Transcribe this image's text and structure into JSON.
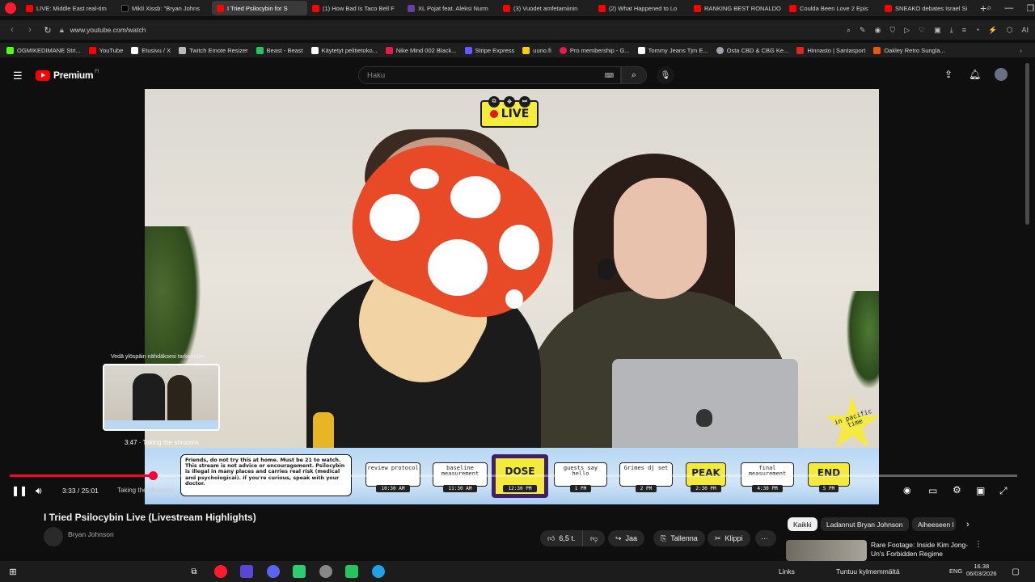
{
  "browser": {
    "tabs": [
      {
        "label": "LIVE: Middle East real-tim",
        "color": "#ff0000"
      },
      {
        "label": "Mikli Xissb: \"Bryan Johns",
        "color": "#000000"
      },
      {
        "label": "I Tried Psilocybin for S",
        "color": "#ff0000",
        "active": true
      },
      {
        "label": "(1) How Bad Is Taco Bell F",
        "color": "#ff0000"
      },
      {
        "label": "XL Pojat feat. Aleksi Nurm",
        "color": "#6441a5"
      },
      {
        "label": "(3) Vuodet amfetamiinin",
        "color": "#ff0000"
      },
      {
        "label": "(2) What Happened to Lo",
        "color": "#ff0000"
      },
      {
        "label": "RANKING BEST RONALDO",
        "color": "#ff0000"
      },
      {
        "label": "Coulda Been Love 2 Epis",
        "color": "#ff0000"
      },
      {
        "label": "SNEAKO debates Israel Si",
        "color": "#ff0000"
      }
    ],
    "url": "www.youtube.com/watch",
    "bookmarks": [
      {
        "label": "OGMIKEDIMANE Stri...",
        "color": "#53fc18"
      },
      {
        "label": "YouTube",
        "color": "#ff0000"
      },
      {
        "label": "Etusivu / X",
        "color": "#ffffff"
      },
      {
        "label": "Twitch Emote Resizer",
        "color": "#bbbbbb"
      },
      {
        "label": "Beast - Beast",
        "color": "#22c55e"
      },
      {
        "label": "Käytetyt pelitietoko...",
        "color": "#ffffff"
      },
      {
        "label": "Nike Mind 002 Black...",
        "color": "#e11d48"
      },
      {
        "label": "Stripe Express",
        "color": "#635bff"
      },
      {
        "label": "uuno.fi",
        "color": "#facc15"
      },
      {
        "label": "Pro membership - G...",
        "color": "#e11d48"
      },
      {
        "label": "Tommy Jeans Tjm E...",
        "color": "#ffffff"
      },
      {
        "label": "Osta CBD & CBG Ke...",
        "color": "#9ca3af"
      },
      {
        "label": "Hinnasto | Santasport",
        "color": "#dc2626"
      },
      {
        "label": "Oakley Retro Sungla...",
        "color": "#ea580c"
      }
    ]
  },
  "youtube": {
    "brand": "Premium",
    "country": "FI",
    "search_placeholder": "Haku"
  },
  "video": {
    "live_label": "LIVE",
    "star_text": "in pacific time",
    "disclaimer": "Friends, do not try this at home. Must be 21 to watch. This stream is not advice or encouragement. Psilocybin is illegal in many places and carries real risk (medical and psychological). If you're curious, speak with your doctor.",
    "steps": [
      {
        "label": "review protocol",
        "time": "10:30 AM"
      },
      {
        "label": "baseline measurement",
        "time": "11:30 AM"
      },
      {
        "label": "DOSE",
        "time": "12:30 PM"
      },
      {
        "label": "guests say hello",
        "time": "1 PM"
      },
      {
        "label": "Grimes dj set",
        "time": "2 PM"
      },
      {
        "label": "PEAK",
        "time": "2:30 PM"
      },
      {
        "label": "final measurement",
        "time": "4:30 PM"
      },
      {
        "label": "END",
        "time": "5 PM"
      }
    ]
  },
  "player": {
    "current_time": "3:33",
    "duration": "25:01",
    "time_display": "3:33 / 25:01",
    "progress_fraction": 0.142,
    "preview_label": "Vedä ylöspäin nähdäksesi tarkemmin",
    "preview_time": "3:47 · Taking the shrooms",
    "chapter": "Taking the shrooms"
  },
  "below": {
    "title": "I Tried Psilocybin Live (Livestream Highlights)",
    "channel": "Bryan Johnson",
    "likes": "6,5 t.",
    "share": "Jaa",
    "save": "Tallenna",
    "clip": "Klippi",
    "chips": [
      "Kaikki",
      "Ladannut Bryan Johnson",
      "Aiheeseen l"
    ],
    "rec_title": "Rare Footage: Inside Kim Jong-Un's Forbidden Regime"
  },
  "taskbar": {
    "links": "Links",
    "weather": "Tuntuu kylmemmältä",
    "lang": "ENG",
    "time": "16.38",
    "date": "06/03/2026"
  }
}
